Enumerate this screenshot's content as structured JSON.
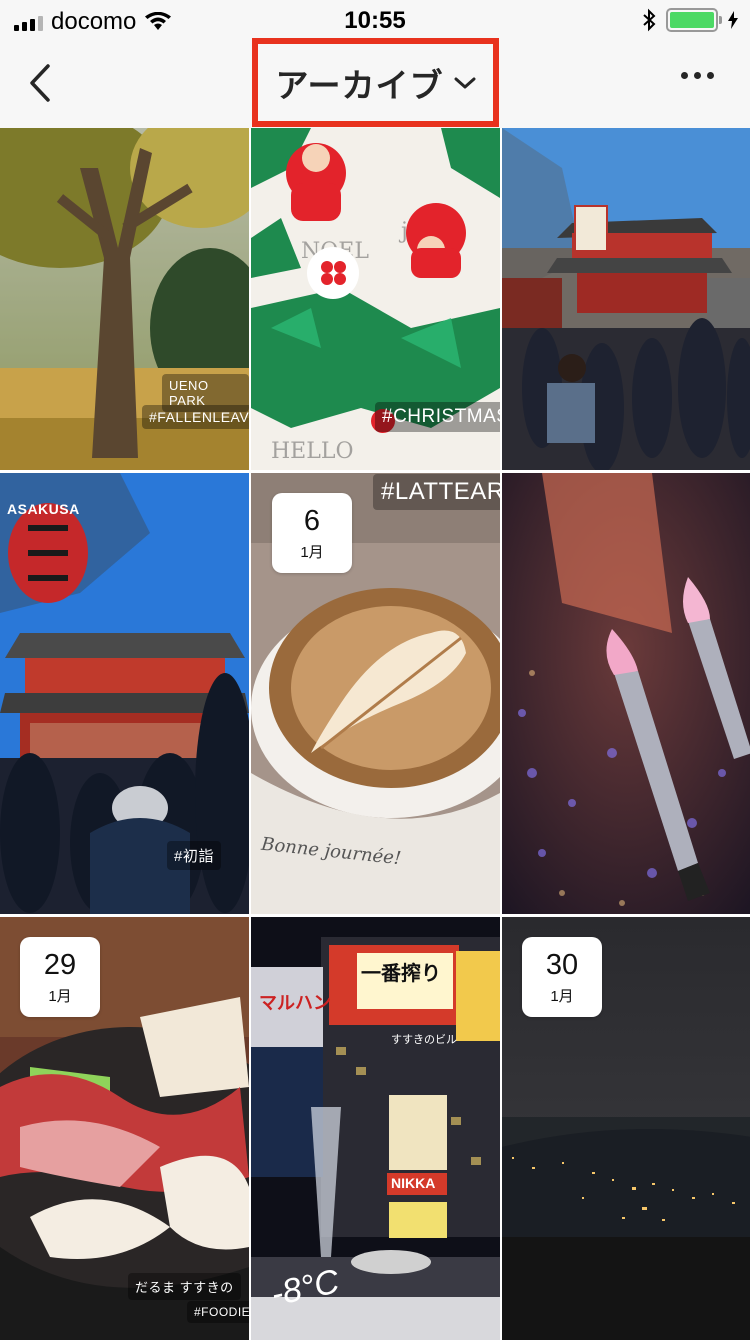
{
  "status_bar": {
    "carrier": "docomo",
    "time": "10:55",
    "battery_color": "#4cd964"
  },
  "nav": {
    "back_icon": "chevron-left-icon",
    "title": "アーカイブ",
    "dropdown_icon": "chevron-down-icon",
    "more_icon": "more-horizontal-icon",
    "highlight_color": "#e8321e"
  },
  "tiles": [
    {
      "name": "ueno-park-tree",
      "stickers": {
        "location": "UENO PARK",
        "hashtag": "#FALLENLEAVES"
      }
    },
    {
      "name": "christmas-santa",
      "stickers": {
        "hashtag": "#CHRISTMAS"
      }
    },
    {
      "name": "asakusa-temple-crowd"
    },
    {
      "name": "asakusa-gate",
      "stickers": {
        "label": "ASAKUSA",
        "hashtag": "#初詣"
      }
    },
    {
      "name": "latte-art",
      "date": {
        "day": "6",
        "month": "1月"
      },
      "stickers": {
        "hashtag": "#LATTEART"
      },
      "cup_text": "Bonne journée!"
    },
    {
      "name": "candle-lights"
    },
    {
      "name": "yakiniku",
      "date": {
        "day": "29",
        "month": "1月"
      },
      "stickers": {
        "location": "だるま すすきの",
        "hashtag": "#FOODIE"
      }
    },
    {
      "name": "susukino-night",
      "stickers": {
        "temp": "-8°C"
      },
      "signs": {
        "sign1": "一番搾り",
        "sign2": "マルハン",
        "sign3": "NIKKA",
        "sign4": "すすきのビル"
      }
    },
    {
      "name": "night-view",
      "date": {
        "day": "30",
        "month": "1月"
      }
    }
  ]
}
